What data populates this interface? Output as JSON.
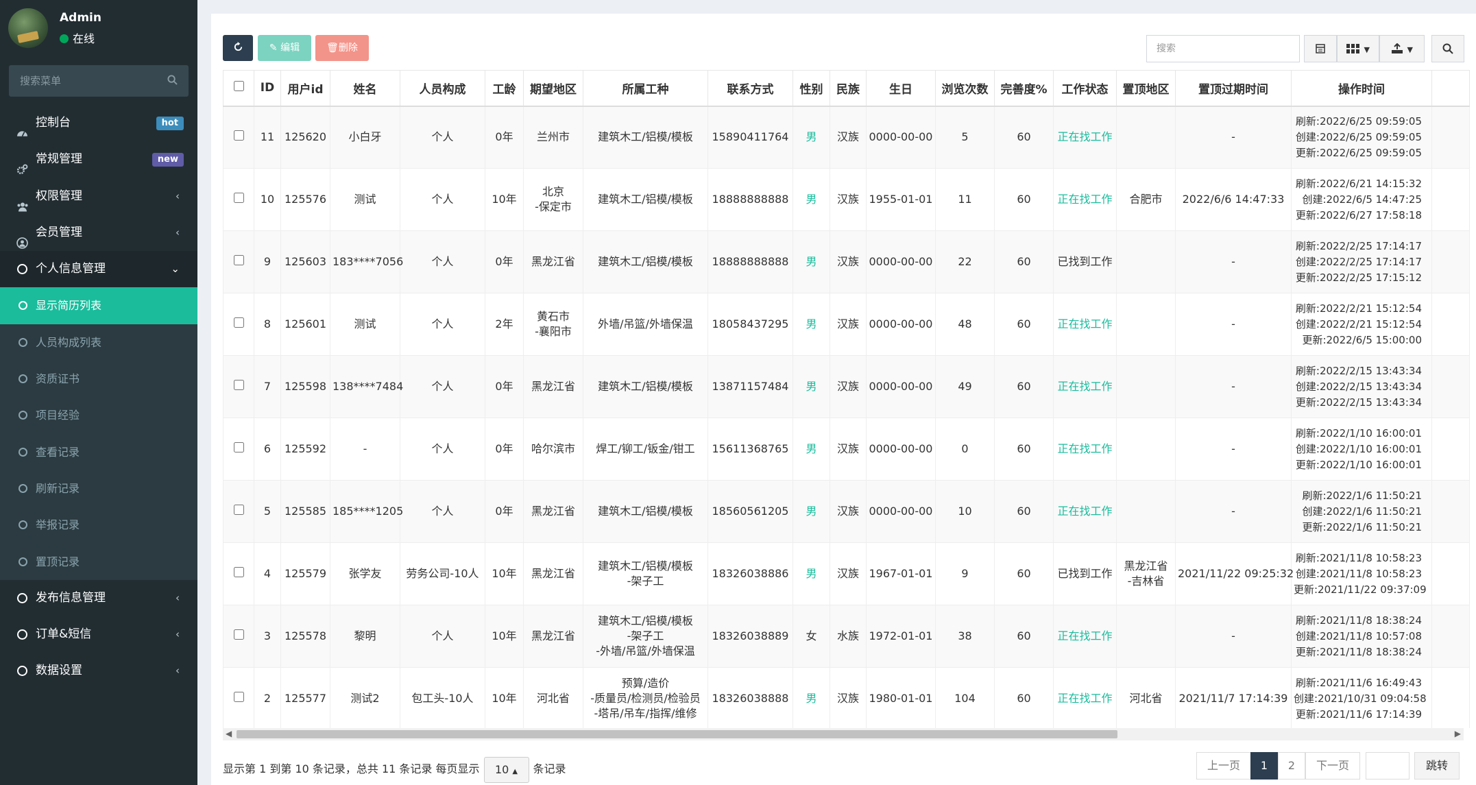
{
  "user": {
    "name": "Admin",
    "status": "在线"
  },
  "sidebar": {
    "search_placeholder": "搜索菜单",
    "items": [
      {
        "label": "控制台",
        "badge": "hot"
      },
      {
        "label": "常规管理",
        "badge": "new"
      },
      {
        "label": "权限管理"
      },
      {
        "label": "会员管理"
      },
      {
        "label": "个人信息管理"
      }
    ],
    "sub_items": [
      "显示简历列表",
      "人员构成列表",
      "资质证书",
      "项目经验",
      "查看记录",
      "刷新记录",
      "举报记录",
      "置顶记录"
    ],
    "bottom_items": [
      "发布信息管理",
      "订单&短信",
      "数据设置"
    ]
  },
  "toolbar": {
    "edit_label": "编辑",
    "delete_label": "删除",
    "search_placeholder": "搜索"
  },
  "table": {
    "headers": [
      "ID",
      "用户id",
      "姓名",
      "人员构成",
      "工龄",
      "期望地区",
      "所属工种",
      "联系方式",
      "性别",
      "民族",
      "生日",
      "浏览次数",
      "完善度%",
      "工作状态",
      "置顶地区",
      "置顶过期时间",
      "操作时间"
    ],
    "rows": [
      {
        "id": "11",
        "uid": "125620",
        "name": "小白牙",
        "comp": "个人",
        "years": "0年",
        "area": [
          "兰州市"
        ],
        "trade": [
          "建筑木工/铝模/模板"
        ],
        "phone": "15890411764",
        "gender": "男",
        "eth": "汉族",
        "birth": "0000-00-00",
        "views": "5",
        "complete": "60",
        "status": "正在找工作",
        "top_area": [],
        "top_exp": "-",
        "refresh": "刷新:2022/6/25 09:59:05",
        "created": "创建:2022/6/25 09:59:05",
        "updated": "更新:2022/6/25 09:59:05"
      },
      {
        "id": "10",
        "uid": "125576",
        "name": "测试",
        "comp": "个人",
        "years": "10年",
        "area": [
          "北京",
          "-保定市"
        ],
        "trade": [
          "建筑木工/铝模/模板"
        ],
        "phone": "18888888888",
        "gender": "男",
        "eth": "汉族",
        "birth": "1955-01-01",
        "views": "11",
        "complete": "60",
        "status": "正在找工作",
        "top_area": [
          "合肥市"
        ],
        "top_exp": "2022/6/6 14:47:33",
        "refresh": "刷新:2022/6/21 14:15:32",
        "created": "创建:2022/6/5 14:47:25",
        "updated": "更新:2022/6/27 17:58:18"
      },
      {
        "id": "9",
        "uid": "125603",
        "name": "183****7056",
        "comp": "个人",
        "years": "0年",
        "area": [
          "黑龙江省"
        ],
        "trade": [
          "建筑木工/铝模/模板"
        ],
        "phone": "18888888888",
        "gender": "男",
        "eth": "汉族",
        "birth": "0000-00-00",
        "views": "22",
        "complete": "60",
        "status": "已找到工作",
        "top_area": [],
        "top_exp": "-",
        "refresh": "刷新:2022/2/25 17:14:17",
        "created": "创建:2022/2/25 17:14:17",
        "updated": "更新:2022/2/25 17:15:12"
      },
      {
        "id": "8",
        "uid": "125601",
        "name": "测试",
        "comp": "个人",
        "years": "2年",
        "area": [
          "黄石市",
          "-襄阳市"
        ],
        "trade": [
          "外墙/吊篮/外墙保温"
        ],
        "phone": "18058437295",
        "gender": "男",
        "eth": "汉族",
        "birth": "0000-00-00",
        "views": "48",
        "complete": "60",
        "status": "正在找工作",
        "top_area": [],
        "top_exp": "-",
        "refresh": "刷新:2022/2/21 15:12:54",
        "created": "创建:2022/2/21 15:12:54",
        "updated": "更新:2022/6/5 15:00:00"
      },
      {
        "id": "7",
        "uid": "125598",
        "name": "138****7484",
        "comp": "个人",
        "years": "0年",
        "area": [
          "黑龙江省"
        ],
        "trade": [
          "建筑木工/铝模/模板"
        ],
        "phone": "13871157484",
        "gender": "男",
        "eth": "汉族",
        "birth": "0000-00-00",
        "views": "49",
        "complete": "60",
        "status": "正在找工作",
        "top_area": [],
        "top_exp": "-",
        "refresh": "刷新:2022/2/15 13:43:34",
        "created": "创建:2022/2/15 13:43:34",
        "updated": "更新:2022/2/15 13:43:34"
      },
      {
        "id": "6",
        "uid": "125592",
        "name": "-",
        "comp": "个人",
        "years": "0年",
        "area": [
          "哈尔滨市"
        ],
        "trade": [
          "焊工/铆工/钣金/钳工"
        ],
        "phone": "15611368765",
        "gender": "男",
        "eth": "汉族",
        "birth": "0000-00-00",
        "views": "0",
        "complete": "60",
        "status": "正在找工作",
        "top_area": [],
        "top_exp": "-",
        "refresh": "刷新:2022/1/10 16:00:01",
        "created": "创建:2022/1/10 16:00:01",
        "updated": "更新:2022/1/10 16:00:01"
      },
      {
        "id": "5",
        "uid": "125585",
        "name": "185****1205",
        "comp": "个人",
        "years": "0年",
        "area": [
          "黑龙江省"
        ],
        "trade": [
          "建筑木工/铝模/模板"
        ],
        "phone": "18560561205",
        "gender": "男",
        "eth": "汉族",
        "birth": "0000-00-00",
        "views": "10",
        "complete": "60",
        "status": "正在找工作",
        "top_area": [],
        "top_exp": "-",
        "refresh": "刷新:2022/1/6 11:50:21",
        "created": "创建:2022/1/6 11:50:21",
        "updated": "更新:2022/1/6 11:50:21"
      },
      {
        "id": "4",
        "uid": "125579",
        "name": "张学友",
        "comp": "劳务公司-10人",
        "years": "10年",
        "area": [
          "黑龙江省"
        ],
        "trade": [
          "建筑木工/铝模/模板",
          "-架子工"
        ],
        "phone": "18326038886",
        "gender": "男",
        "eth": "汉族",
        "birth": "1967-01-01",
        "views": "9",
        "complete": "60",
        "status": "已找到工作",
        "top_area": [
          "黑龙江省",
          "-吉林省"
        ],
        "top_exp": "2021/11/22 09:25:32",
        "refresh": "刷新:2021/11/8 10:58:23",
        "created": "创建:2021/11/8 10:58:23",
        "updated": "更新:2021/11/22 09:37:09"
      },
      {
        "id": "3",
        "uid": "125578",
        "name": "黎明",
        "comp": "个人",
        "years": "10年",
        "area": [
          "黑龙江省"
        ],
        "trade": [
          "建筑木工/铝模/模板",
          "-架子工",
          "-外墙/吊篮/外墙保温"
        ],
        "phone": "18326038889",
        "gender": "女",
        "eth": "水族",
        "birth": "1972-01-01",
        "views": "38",
        "complete": "60",
        "status": "正在找工作",
        "top_area": [],
        "top_exp": "-",
        "refresh": "刷新:2021/11/8 18:38:24",
        "created": "创建:2021/11/8 10:57:08",
        "updated": "更新:2021/11/8 18:38:24"
      },
      {
        "id": "2",
        "uid": "125577",
        "name": "测试2",
        "comp": "包工头-10人",
        "years": "10年",
        "area": [
          "河北省"
        ],
        "trade": [
          "预算/造价",
          "-质量员/检测员/检验员",
          "-塔吊/吊车/指挥/维修"
        ],
        "phone": "18326038888",
        "gender": "男",
        "eth": "汉族",
        "birth": "1980-01-01",
        "views": "104",
        "complete": "60",
        "status": "正在找工作",
        "top_area": [
          "河北省"
        ],
        "top_exp": "2021/11/7 17:14:39",
        "refresh": "刷新:2021/11/6 16:49:43",
        "created": "创建:2021/10/31 09:04:58",
        "updated": "更新:2021/11/6 17:14:39"
      }
    ]
  },
  "pagination": {
    "info": "显示第 1 到第 10 条记录，总共 11 条记录 每页显示",
    "page_size": "10",
    "suffix": "条记录",
    "prev": "上一页",
    "page1": "1",
    "page2": "2",
    "next": "下一页",
    "jump": "跳转"
  },
  "colors": {
    "sidebar": "#222d32",
    "active": "#1abc9c",
    "green": "#18bc9c",
    "dark": "#2c3e50"
  }
}
